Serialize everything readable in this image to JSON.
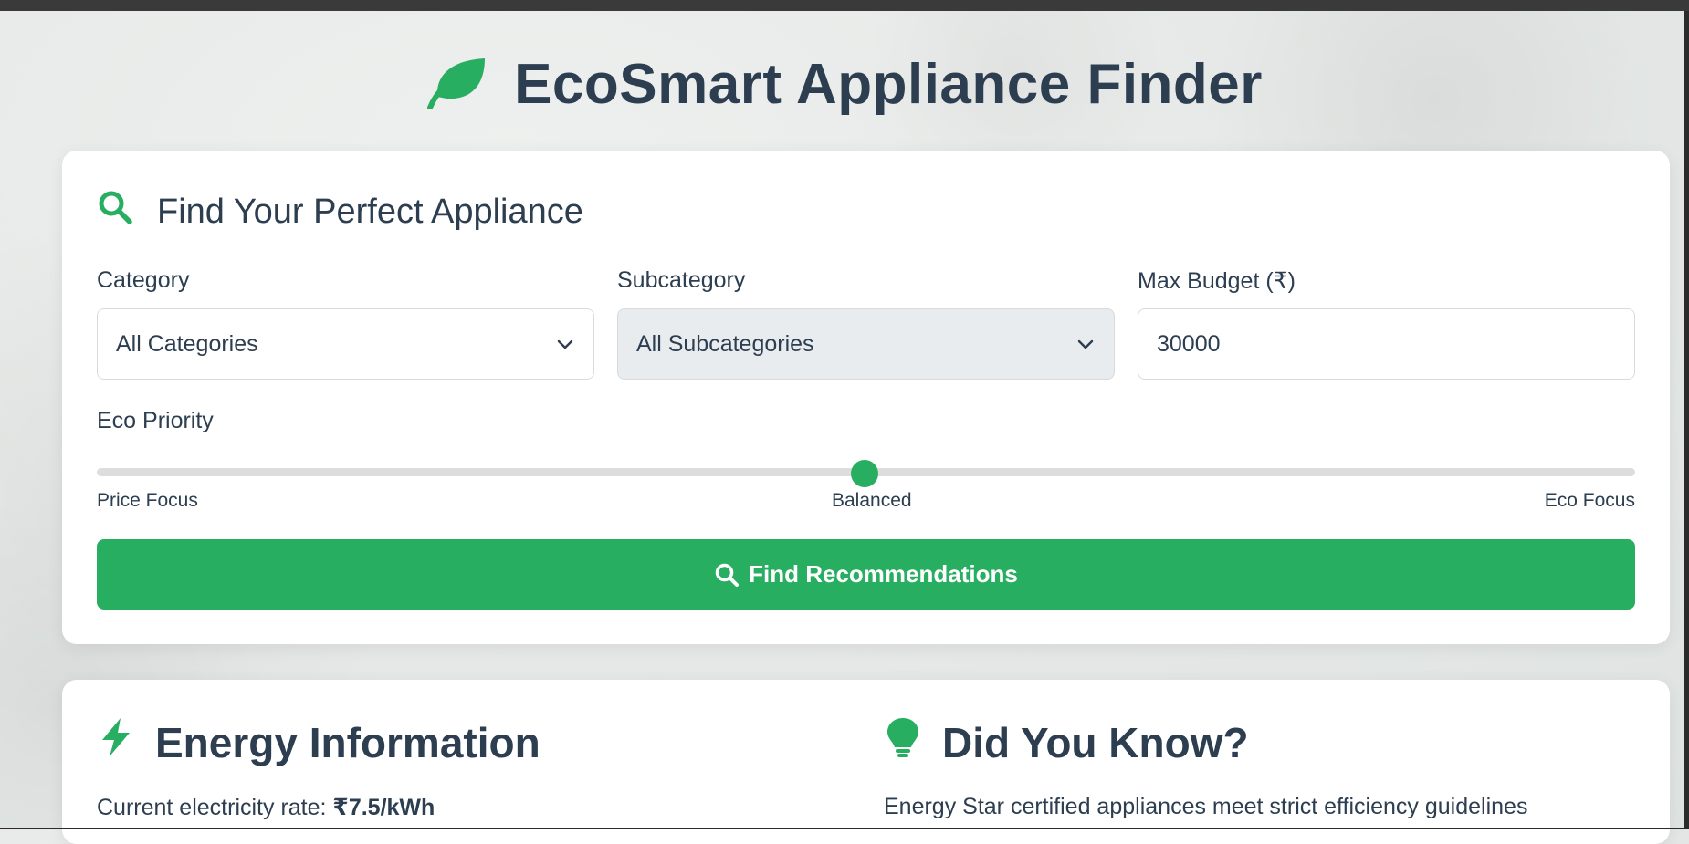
{
  "app": {
    "title": "EcoSmart Appliance Finder",
    "icon": "leaf-icon"
  },
  "search": {
    "title": "Find Your Perfect Appliance",
    "icon": "search-icon",
    "category": {
      "label": "Category",
      "value": "All Categories"
    },
    "subcategory": {
      "label": "Subcategory",
      "value": "All Subcategories"
    },
    "budget": {
      "label": "Max Budget (₹)",
      "value": "30000"
    },
    "eco_priority": {
      "label": "Eco Priority",
      "value": 0.5,
      "left_label": "Price Focus",
      "middle_label": "Balanced",
      "right_label": "Eco Focus"
    },
    "button_label": "Find Recommendations"
  },
  "energy": {
    "title": "Energy Information",
    "icon": "bolt-icon",
    "rate_prefix": "Current electricity rate: ",
    "rate_value": "₹7.5/kWh"
  },
  "tips": {
    "title": "Did You Know?",
    "icon": "lightbulb-icon",
    "text": "Energy Star certified appliances meet strict efficiency guidelines"
  },
  "colors": {
    "accent": "#27ae60",
    "text": "#2c3e50"
  }
}
